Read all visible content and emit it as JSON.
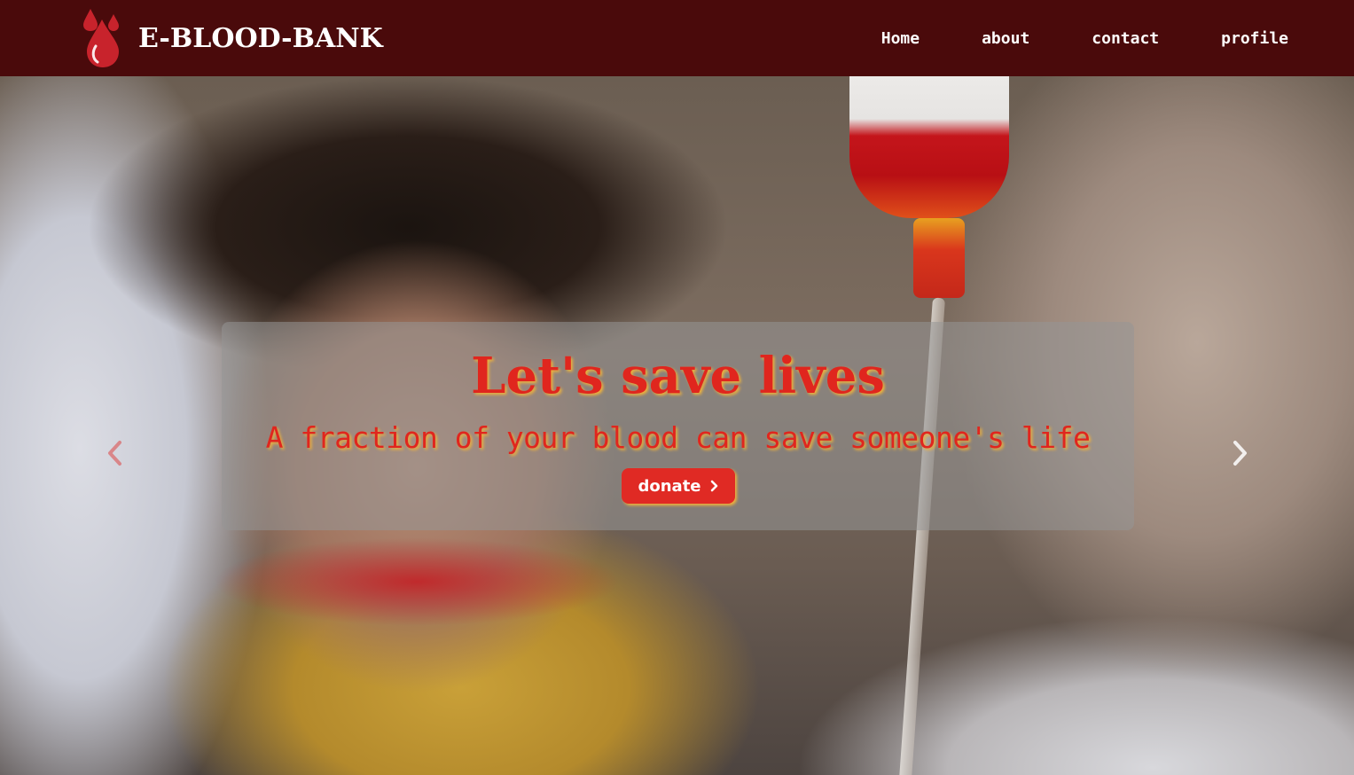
{
  "navbar": {
    "brand_name": "E-BLOOD-BANK",
    "brand_icon": "blood-drops-icon",
    "links": [
      {
        "label": "Home"
      },
      {
        "label": "about"
      },
      {
        "label": "contact"
      },
      {
        "label": "profile"
      }
    ]
  },
  "hero": {
    "title": "Let's save lives",
    "subtitle": "A fraction of your blood can save someone's life",
    "button_label": "donate",
    "button_icon": "chevron-right-icon",
    "prev_icon": "chevron-left-icon",
    "next_icon": "chevron-right-icon"
  },
  "colors": {
    "navbar_bg": "#4a0a0b",
    "accent_red": "#e0261e",
    "glow_orange": "#f2b33a",
    "button_bg": "#e02a24"
  }
}
